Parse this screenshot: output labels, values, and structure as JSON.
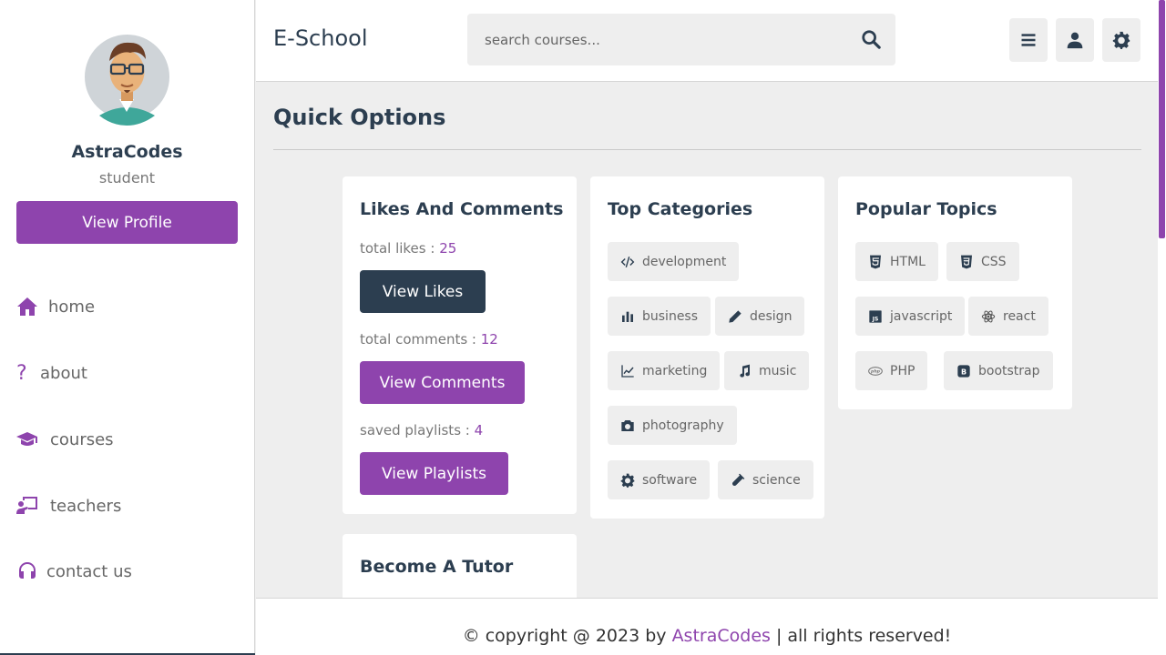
{
  "colors": {
    "accent": "#8e44ad",
    "dark": "#2c3e50",
    "background": "#eeeeee"
  },
  "sidebar": {
    "profile": {
      "name": "AstraCodes",
      "role": "student",
      "button_label": "View Profile"
    },
    "nav": [
      {
        "label": "home",
        "icon": "home-icon"
      },
      {
        "label": "about",
        "icon": "question-icon"
      },
      {
        "label": "courses",
        "icon": "graduation-cap-icon"
      },
      {
        "label": "teachers",
        "icon": "chalkboard-teacher-icon"
      },
      {
        "label": "contact us",
        "icon": "headset-icon"
      }
    ]
  },
  "header": {
    "logo": "E-School",
    "search_placeholder": "search courses...",
    "buttons": [
      "menu-icon",
      "user-icon",
      "gear-icon"
    ]
  },
  "main": {
    "heading": "Quick Options",
    "likes_card": {
      "title": "Likes And Comments",
      "likes_label": "total likes : ",
      "likes_value": "25",
      "likes_button": "View Likes",
      "comments_label": "total comments : ",
      "comments_value": "12",
      "comments_button": "View Comments",
      "playlists_label": "saved playlists : ",
      "playlists_value": "4",
      "playlists_button": "View Playlists"
    },
    "categories_card": {
      "title": "Top Categories",
      "items": [
        {
          "label": "development",
          "icon": "code-icon"
        },
        {
          "label": "business",
          "icon": "bar-chart-icon"
        },
        {
          "label": "design",
          "icon": "pen-icon"
        },
        {
          "label": "marketing",
          "icon": "line-chart-icon"
        },
        {
          "label": "music",
          "icon": "music-note-icon"
        },
        {
          "label": "photography",
          "icon": "camera-icon"
        },
        {
          "label": "software",
          "icon": "gear-icon"
        },
        {
          "label": "science",
          "icon": "vial-icon"
        }
      ]
    },
    "topics_card": {
      "title": "Popular Topics",
      "items": [
        {
          "label": "HTML",
          "icon": "html5-icon"
        },
        {
          "label": "CSS",
          "icon": "css3-icon"
        },
        {
          "label": "javascript",
          "icon": "js-icon"
        },
        {
          "label": "react",
          "icon": "react-icon"
        },
        {
          "label": "PHP",
          "icon": "php-icon"
        },
        {
          "label": "bootstrap",
          "icon": "bootstrap-icon"
        }
      ]
    },
    "tutor_card": {
      "title": "Become A Tutor"
    }
  },
  "footer": {
    "prefix": "© copyright @ 2023 by ",
    "brand": "AstraCodes",
    "suffix": " | all rights reserved!"
  }
}
